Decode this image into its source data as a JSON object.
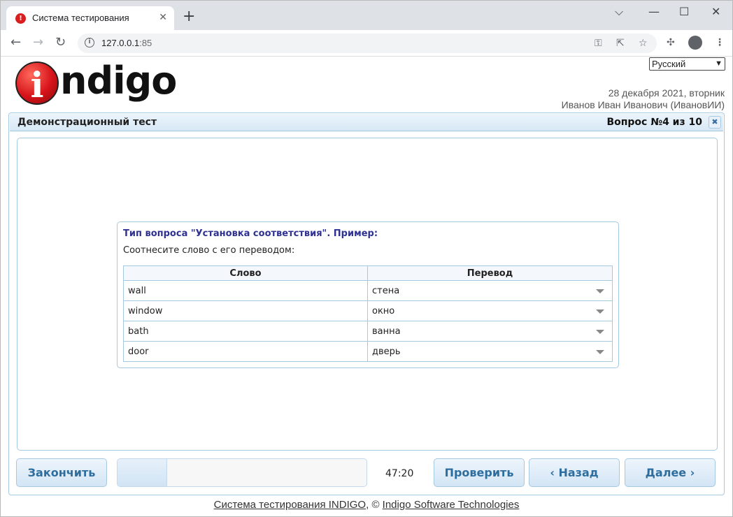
{
  "browser": {
    "tab_title": "Система тестирования",
    "tab_favicon": "!",
    "tab_close": "✕",
    "new_tab": "+",
    "url_host": "127.0.0.1",
    "url_port": ":85",
    "window_controls": {
      "minimize": "⌵",
      "restore": "—",
      "maximize": "☐",
      "close": "✕"
    }
  },
  "header": {
    "logo_letter": "i",
    "logo_text": "ndigo",
    "language": "Русский",
    "date": "28 декабря 2021, вторник",
    "user": "Иванов Иван Иванович (ИвановИИ)"
  },
  "panel": {
    "title": "Демонстрационный тест",
    "question_number": "Вопрос №4 из 10",
    "close_glyph": "✖"
  },
  "question": {
    "type": "Тип вопроса \"Установка соответствия\". Пример:",
    "text": "Соотнесите слово с его переводом:",
    "columns": [
      "Слово",
      "Перевод"
    ],
    "rows": [
      {
        "word": "wall",
        "translation": "стена"
      },
      {
        "word": "window",
        "translation": "окно"
      },
      {
        "word": "bath",
        "translation": "ванна"
      },
      {
        "word": "door",
        "translation": "дверь"
      }
    ]
  },
  "controls": {
    "finish": "Закончить",
    "check": "Проверить",
    "back": "‹ Назад",
    "next": "Далее ›",
    "timer": "47:20",
    "progress": 0.2
  },
  "footer": {
    "system": "Система тестирования INDIGO",
    "separator": ", © ",
    "company": "Indigo Software Technologies"
  },
  "colors": {
    "accent": "#2e3192",
    "button_text": "#2e6e9e",
    "border": "#a6c9e2"
  }
}
